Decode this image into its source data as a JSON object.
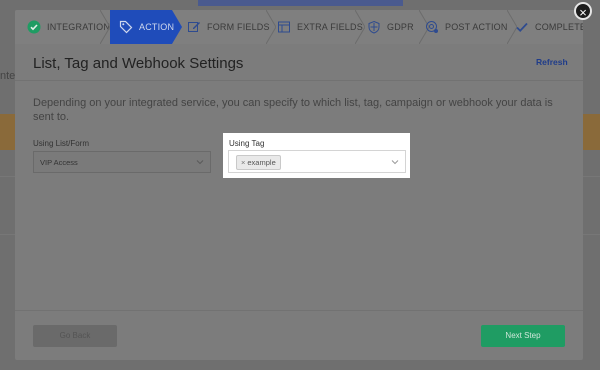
{
  "background": {
    "partial_text": "nte"
  },
  "close_symbol": "×",
  "steps": [
    {
      "label": "Integration",
      "icon": "check-circle-icon",
      "state": "done"
    },
    {
      "label": "Action",
      "icon": "tag-icon",
      "state": "active"
    },
    {
      "label": "Form Fields",
      "icon": "edit-icon",
      "state": "pending"
    },
    {
      "label": "Extra Fields",
      "icon": "table-icon",
      "state": "pending"
    },
    {
      "label": "GDPR",
      "icon": "shield-icon",
      "state": "pending"
    },
    {
      "label": "Post Action",
      "icon": "settings-icon",
      "state": "pending"
    },
    {
      "label": "Complete",
      "icon": "check-icon",
      "state": "pending"
    }
  ],
  "modal": {
    "title": "List, Tag and Webhook Settings",
    "refresh_label": "Refresh",
    "description": "Depending on your integrated service, you can specify to which list, tag, campaign or webhook your data is sent to.",
    "list_field": {
      "label": "Using List/Form",
      "value": "VIP Access"
    },
    "tag_field": {
      "label": "Using Tag",
      "tags": [
        "example"
      ],
      "remove_symbol": "×"
    },
    "back_label": "Go Back",
    "next_label": "Next Step"
  },
  "colors": {
    "active_step": "#1f4cba",
    "done_check": "#1f9c63",
    "next_button": "#1f9c63",
    "refresh_link": "#1f3c8a"
  }
}
